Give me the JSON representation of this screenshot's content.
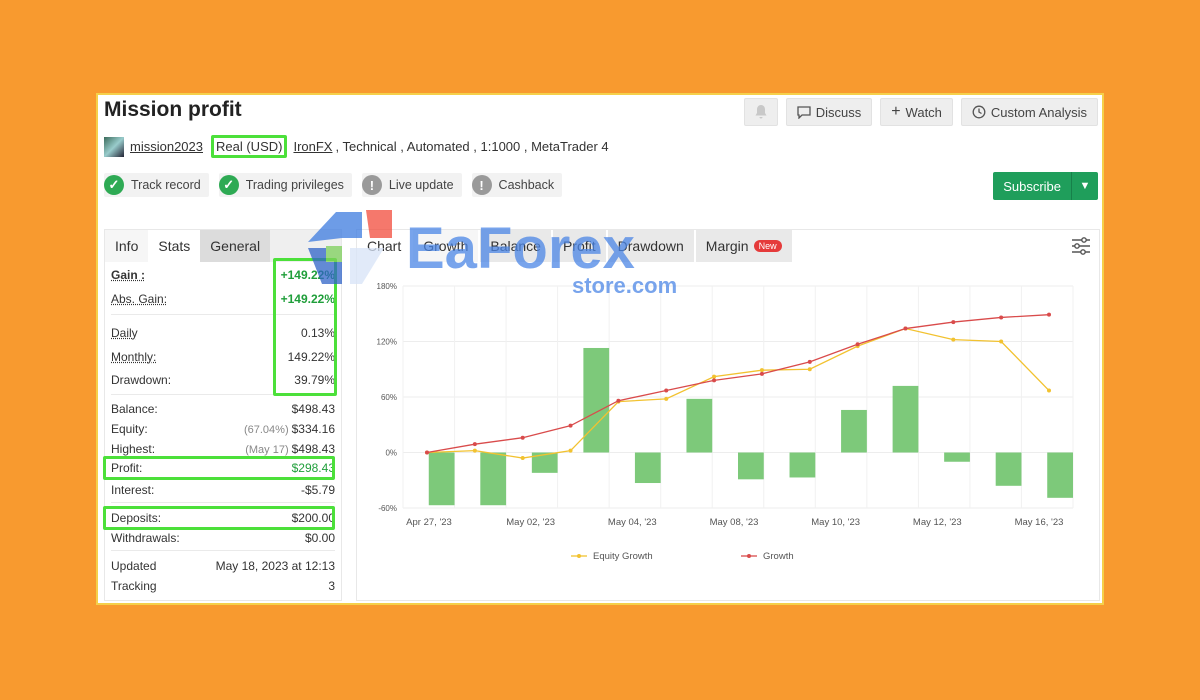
{
  "header": {
    "title": "Mission profit",
    "actions": {
      "discuss": "Discuss",
      "watch": "Watch",
      "custom_analysis": "Custom Analysis"
    }
  },
  "account": {
    "username": "mission2023",
    "account_type": "Real (USD)",
    "broker": "IronFX",
    "details": ", Technical , Automated , 1:1000 , MetaTrader 4"
  },
  "badges": [
    {
      "label": "Track record",
      "status": "ok"
    },
    {
      "label": "Trading privileges",
      "status": "ok"
    },
    {
      "label": "Live update",
      "status": "warn"
    },
    {
      "label": "Cashback",
      "status": "warn"
    }
  ],
  "subscribe_label": "Subscribe",
  "left_tabs": [
    "Info",
    "Stats",
    "General"
  ],
  "stats": {
    "gain_label": "Gain :",
    "gain": "+149.22%",
    "abs_gain_label": "Abs. Gain:",
    "abs_gain": "+149.22%",
    "daily_label": "Daily",
    "daily": "0.13%",
    "monthly_label": "Monthly:",
    "monthly": "149.22%",
    "drawdown_label": "Drawdown:",
    "drawdown": "39.79%",
    "balance_label": "Balance:",
    "balance": "$498.43",
    "equity_label": "Equity:",
    "equity_pct": "(67.04%)",
    "equity": "$334.16",
    "highest_label": "Highest:",
    "highest_date": "(May 17)",
    "highest": "$498.43",
    "profit_label": "Profit:",
    "profit": "$298.43",
    "interest_label": "Interest:",
    "interest": "-$5.79",
    "deposits_label": "Deposits:",
    "deposits": "$200.00",
    "withdrawals_label": "Withdrawals:",
    "withdrawals": "$0.00",
    "updated_label": "Updated",
    "updated": "May 18, 2023 at 12:13",
    "tracking_label": "Tracking",
    "tracking": "3"
  },
  "chart_tabs": [
    "Chart",
    "Growth",
    "Balance",
    "Profit",
    "Drawdown",
    "Margin"
  ],
  "new_badge": "New",
  "watermark": {
    "brand": "EaForex",
    "sub": "store.com"
  },
  "chart_data": {
    "type": "bar",
    "x_ticks": [
      "Apr 27, '23",
      "May 02, '23",
      "May 04, '23",
      "May 08, '23",
      "May 10, '23",
      "May 12, '23",
      "May 16, '23"
    ],
    "y_ticks": [
      "180%",
      "120%",
      "60%",
      "0%",
      "-60%"
    ],
    "ylim": [
      -60,
      180
    ],
    "bars": [
      -57,
      -57,
      -22,
      113,
      -33,
      58,
      -29,
      -27,
      46,
      72,
      -10,
      -36,
      -49
    ],
    "series": [
      {
        "name": "Equity Growth",
        "color": "#F2C230",
        "values": [
          0,
          2,
          -6,
          2,
          55,
          58,
          82,
          89,
          90,
          115,
          134,
          122,
          120,
          67
        ]
      },
      {
        "name": "Growth",
        "color": "#D94B4B",
        "values": [
          0,
          9,
          16,
          29,
          56,
          67,
          78,
          85,
          98,
          117,
          134,
          141,
          146,
          149
        ]
      }
    ],
    "legend": "bottom",
    "grid": true
  }
}
